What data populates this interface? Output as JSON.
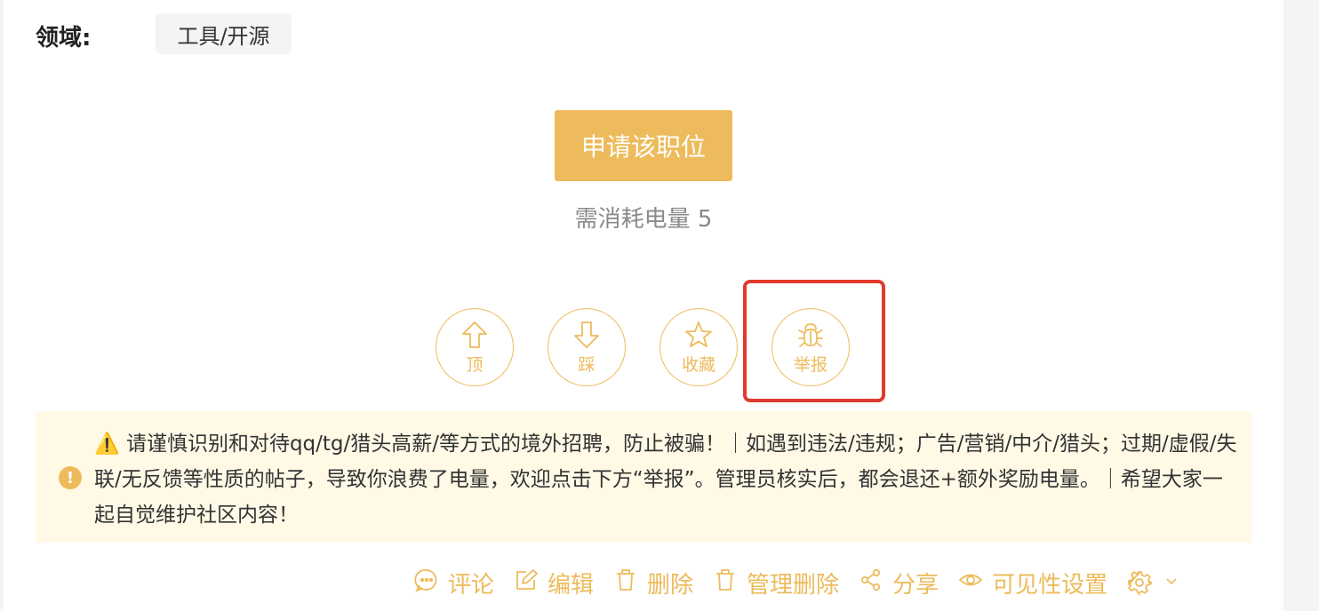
{
  "field": {
    "label": "领域:",
    "tag": "工具/开源"
  },
  "apply": {
    "button_label": "申请该职位",
    "cost_text": "需消耗电量 5"
  },
  "actions": [
    {
      "label": "顶",
      "icon": "arrow-up-icon"
    },
    {
      "label": "踩",
      "icon": "arrow-down-icon"
    },
    {
      "label": "收藏",
      "icon": "star-icon"
    },
    {
      "label": "举报",
      "icon": "bug-icon"
    }
  ],
  "notice": {
    "icon_text": "!",
    "warn_glyph": "⚠️",
    "text": "请谨慎识别和对待qq/tg/猎头高薪/等方式的境外招聘，防止被骗！｜如遇到违法/违规；广告/营销/中介/猎头；过期/虚假/失联/无反馈等性质的帖子，导致你浪费了电量，欢迎点击下方“举报”。管理员核实后，都会退还+额外奖励电量。｜希望大家一起自觉维护社区内容！"
  },
  "toolbar": [
    {
      "label": "评论",
      "icon": "comment-icon"
    },
    {
      "label": "编辑",
      "icon": "edit-icon"
    },
    {
      "label": "删除",
      "icon": "trash-icon"
    },
    {
      "label": "管理删除",
      "icon": "trash-icon"
    },
    {
      "label": "分享",
      "icon": "share-icon"
    },
    {
      "label": "可见性设置",
      "icon": "eye-icon"
    }
  ],
  "colors": {
    "accent": "#edbb5b",
    "highlight": "#e03a2f",
    "notice_bg": "#fff9e6"
  }
}
